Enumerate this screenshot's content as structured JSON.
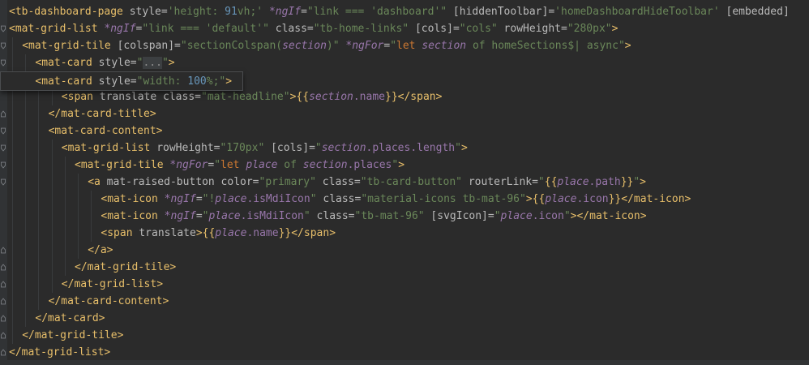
{
  "editor": {
    "background": "#2b2b2b",
    "gutter_background": "#313335",
    "colors": {
      "tag": "#e8bf6a",
      "attribute": "#bababa",
      "string": "#6a8759",
      "keyword": "#cc7832",
      "variable": "#9876aa",
      "number": "#6897bb",
      "text": "#a9b7c6"
    },
    "fold_icon": "fold-marker-icon",
    "lines": [
      {
        "indent": 0,
        "fold": "none",
        "tokens": [
          {
            "t": "<tb-dashboard-page ",
            "c": "tk-tag"
          },
          {
            "t": "style=",
            "c": "tk-attr"
          },
          {
            "t": "'height: ",
            "c": "tk-str"
          },
          {
            "t": "91",
            "c": "tk-num"
          },
          {
            "t": "vh;'",
            "c": "tk-str"
          },
          {
            "t": " ",
            "c": "tk-text"
          },
          {
            "t": "*ngIf",
            "c": "tk-ngs"
          },
          {
            "t": "=",
            "c": "tk-attr"
          },
          {
            "t": "\"link === ",
            "c": "tk-str"
          },
          {
            "t": "'dashboard'",
            "c": "tk-str"
          },
          {
            "t": "\"",
            "c": "tk-str"
          },
          {
            "t": " [hiddenToolbar]",
            "c": "tk-ng"
          },
          {
            "t": "=",
            "c": "tk-attr"
          },
          {
            "t": "'homeDashboardHideToolbar'",
            "c": "tk-str"
          },
          {
            "t": " [embedded]",
            "c": "tk-ng"
          }
        ]
      },
      {
        "indent": 0,
        "fold": "open",
        "tokens": [
          {
            "t": "<mat-grid-list ",
            "c": "tk-tag"
          },
          {
            "t": "*ngIf",
            "c": "tk-ngs"
          },
          {
            "t": "=",
            "c": "tk-attr"
          },
          {
            "t": "\"link === ",
            "c": "tk-str"
          },
          {
            "t": "'default'",
            "c": "tk-str"
          },
          {
            "t": "\"",
            "c": "tk-str"
          },
          {
            "t": " class=",
            "c": "tk-attr"
          },
          {
            "t": "\"tb-home-links\"",
            "c": "tk-str"
          },
          {
            "t": " [cols]",
            "c": "tk-ng"
          },
          {
            "t": "=",
            "c": "tk-attr"
          },
          {
            "t": "\"cols\"",
            "c": "tk-str"
          },
          {
            "t": " rowHeight=",
            "c": "tk-attr"
          },
          {
            "t": "\"280px\"",
            "c": "tk-str"
          },
          {
            "t": ">",
            "c": "tk-tag"
          }
        ]
      },
      {
        "indent": 1,
        "fold": "open",
        "tokens": [
          {
            "t": "<mat-grid-tile ",
            "c": "tk-tag"
          },
          {
            "t": "[colspan]",
            "c": "tk-ng"
          },
          {
            "t": "=",
            "c": "tk-attr"
          },
          {
            "t": "\"sectionColspan(",
            "c": "tk-str"
          },
          {
            "t": "section",
            "c": "tk-var"
          },
          {
            "t": ")\"",
            "c": "tk-str"
          },
          {
            "t": " ",
            "c": "tk-text"
          },
          {
            "t": "*ngFor",
            "c": "tk-ngs"
          },
          {
            "t": "=",
            "c": "tk-attr"
          },
          {
            "t": "\"",
            "c": "tk-str"
          },
          {
            "t": "let ",
            "c": "tk-kw"
          },
          {
            "t": "section",
            "c": "tk-var"
          },
          {
            "t": " of homeSections$| async\"",
            "c": "tk-str"
          },
          {
            "t": ">",
            "c": "tk-tag"
          }
        ]
      },
      {
        "indent": 2,
        "fold": "open",
        "tokens": [
          {
            "t": "<mat-card ",
            "c": "tk-tag"
          },
          {
            "t": "style=",
            "c": "tk-attr"
          },
          {
            "t": "\"",
            "c": "tk-str"
          },
          {
            "t": "...",
            "c": "tk-fold"
          },
          {
            "t": "\"",
            "c": "tk-str"
          },
          {
            "t": ">",
            "c": "tk-tag"
          }
        ]
      },
      {
        "indent": 3,
        "fold": "open",
        "tokens": []
      },
      {
        "indent": 4,
        "fold": "none",
        "tokens": [
          {
            "t": "<span ",
            "c": "tk-tag"
          },
          {
            "t": "translate class=",
            "c": "tk-attr"
          },
          {
            "t": "\"mat-headline\"",
            "c": "tk-str"
          },
          {
            "t": ">",
            "c": "tk-tag"
          },
          {
            "t": "{{",
            "c": "tk-interp"
          },
          {
            "t": "section",
            "c": "tk-var"
          },
          {
            "t": ".name",
            "c": "tk-bind"
          },
          {
            "t": "}}",
            "c": "tk-interp"
          },
          {
            "t": "</span>",
            "c": "tk-tag"
          }
        ]
      },
      {
        "indent": 3,
        "fold": "close",
        "tokens": [
          {
            "t": "</mat-card-title>",
            "c": "tk-tag"
          }
        ]
      },
      {
        "indent": 3,
        "fold": "open",
        "tokens": [
          {
            "t": "<mat-card-content>",
            "c": "tk-tag"
          }
        ]
      },
      {
        "indent": 4,
        "fold": "open",
        "tokens": [
          {
            "t": "<mat-grid-list ",
            "c": "tk-tag"
          },
          {
            "t": "rowHeight=",
            "c": "tk-attr"
          },
          {
            "t": "\"170px\"",
            "c": "tk-str"
          },
          {
            "t": " [cols]",
            "c": "tk-ng"
          },
          {
            "t": "=",
            "c": "tk-attr"
          },
          {
            "t": "\"",
            "c": "tk-str"
          },
          {
            "t": "section",
            "c": "tk-var"
          },
          {
            "t": ".places.length",
            "c": "tk-bind"
          },
          {
            "t": "\"",
            "c": "tk-str"
          },
          {
            "t": ">",
            "c": "tk-tag"
          }
        ]
      },
      {
        "indent": 5,
        "fold": "open",
        "tokens": [
          {
            "t": "<mat-grid-tile ",
            "c": "tk-tag"
          },
          {
            "t": "*ngFor",
            "c": "tk-ngs"
          },
          {
            "t": "=",
            "c": "tk-attr"
          },
          {
            "t": "\"",
            "c": "tk-str"
          },
          {
            "t": "let ",
            "c": "tk-kw"
          },
          {
            "t": "place",
            "c": "tk-var"
          },
          {
            "t": " of ",
            "c": "tk-str"
          },
          {
            "t": "section",
            "c": "tk-var"
          },
          {
            "t": ".places",
            "c": "tk-bind"
          },
          {
            "t": "\"",
            "c": "tk-str"
          },
          {
            "t": ">",
            "c": "tk-tag"
          }
        ]
      },
      {
        "indent": 6,
        "fold": "open",
        "tokens": [
          {
            "t": "<a ",
            "c": "tk-tag"
          },
          {
            "t": "mat-raised-button color=",
            "c": "tk-attr"
          },
          {
            "t": "\"primary\"",
            "c": "tk-str"
          },
          {
            "t": " class=",
            "c": "tk-attr"
          },
          {
            "t": "\"tb-card-button\"",
            "c": "tk-str"
          },
          {
            "t": " routerLink=",
            "c": "tk-attr"
          },
          {
            "t": "\"",
            "c": "tk-str"
          },
          {
            "t": "{{",
            "c": "tk-interp"
          },
          {
            "t": "place",
            "c": "tk-var"
          },
          {
            "t": ".path",
            "c": "tk-bind"
          },
          {
            "t": "}}",
            "c": "tk-interp"
          },
          {
            "t": "\"",
            "c": "tk-str"
          },
          {
            "t": ">",
            "c": "tk-tag"
          }
        ]
      },
      {
        "indent": 7,
        "fold": "none",
        "tokens": [
          {
            "t": "<mat-icon ",
            "c": "tk-tag"
          },
          {
            "t": "*ngIf",
            "c": "tk-ngs"
          },
          {
            "t": "=",
            "c": "tk-attr"
          },
          {
            "t": "\"!",
            "c": "tk-str"
          },
          {
            "t": "place",
            "c": "tk-var"
          },
          {
            "t": ".isMdiIcon",
            "c": "tk-bind"
          },
          {
            "t": "\"",
            "c": "tk-str"
          },
          {
            "t": " class=",
            "c": "tk-attr"
          },
          {
            "t": "\"material-icons tb-mat-96\"",
            "c": "tk-str"
          },
          {
            "t": ">",
            "c": "tk-tag"
          },
          {
            "t": "{{",
            "c": "tk-interp"
          },
          {
            "t": "place",
            "c": "tk-var"
          },
          {
            "t": ".icon",
            "c": "tk-bind"
          },
          {
            "t": "}}",
            "c": "tk-interp"
          },
          {
            "t": "</mat-icon>",
            "c": "tk-tag"
          }
        ]
      },
      {
        "indent": 7,
        "fold": "none",
        "tokens": [
          {
            "t": "<mat-icon ",
            "c": "tk-tag"
          },
          {
            "t": "*ngIf",
            "c": "tk-ngs"
          },
          {
            "t": "=",
            "c": "tk-attr"
          },
          {
            "t": "\"",
            "c": "tk-str"
          },
          {
            "t": "place",
            "c": "tk-var"
          },
          {
            "t": ".isMdiIcon",
            "c": "tk-bind"
          },
          {
            "t": "\"",
            "c": "tk-str"
          },
          {
            "t": " class=",
            "c": "tk-attr"
          },
          {
            "t": "\"tb-mat-96\"",
            "c": "tk-str"
          },
          {
            "t": " [svgIcon]",
            "c": "tk-ng"
          },
          {
            "t": "=",
            "c": "tk-attr"
          },
          {
            "t": "\"",
            "c": "tk-str"
          },
          {
            "t": "place",
            "c": "tk-var"
          },
          {
            "t": ".icon",
            "c": "tk-bind"
          },
          {
            "t": "\"",
            "c": "tk-str"
          },
          {
            "t": "></mat-icon>",
            "c": "tk-tag"
          }
        ]
      },
      {
        "indent": 7,
        "fold": "none",
        "tokens": [
          {
            "t": "<span ",
            "c": "tk-tag"
          },
          {
            "t": "translate",
            "c": "tk-attr"
          },
          {
            "t": ">",
            "c": "tk-tag"
          },
          {
            "t": "{{",
            "c": "tk-interp"
          },
          {
            "t": "place",
            "c": "tk-var"
          },
          {
            "t": ".name",
            "c": "tk-bind"
          },
          {
            "t": "}}",
            "c": "tk-interp"
          },
          {
            "t": "</span>",
            "c": "tk-tag"
          }
        ]
      },
      {
        "indent": 6,
        "fold": "close",
        "tokens": [
          {
            "t": "</a>",
            "c": "tk-tag"
          }
        ]
      },
      {
        "indent": 5,
        "fold": "close",
        "tokens": [
          {
            "t": "</mat-grid-tile>",
            "c": "tk-tag"
          }
        ]
      },
      {
        "indent": 4,
        "fold": "close",
        "tokens": [
          {
            "t": "</mat-grid-list>",
            "c": "tk-tag"
          }
        ]
      },
      {
        "indent": 3,
        "fold": "close",
        "tokens": [
          {
            "t": "</mat-card-content>",
            "c": "tk-tag"
          }
        ]
      },
      {
        "indent": 2,
        "fold": "close",
        "tokens": [
          {
            "t": "</mat-card>",
            "c": "tk-tag"
          }
        ]
      },
      {
        "indent": 1,
        "fold": "close",
        "tokens": [
          {
            "t": "</mat-grid-tile>",
            "c": "tk-tag"
          }
        ]
      },
      {
        "indent": 0,
        "fold": "close",
        "tokens": [
          {
            "t": "</mat-grid-list>",
            "c": "tk-tag"
          }
        ]
      }
    ],
    "popup": {
      "tokens": [
        {
          "t": "<mat-card ",
          "c": "tk-tag"
        },
        {
          "t": "style=",
          "c": "tk-attr"
        },
        {
          "t": "\"width: ",
          "c": "tk-str"
        },
        {
          "t": "100",
          "c": "tk-num"
        },
        {
          "t": "%;\"",
          "c": "tk-str"
        },
        {
          "t": ">",
          "c": "tk-tag"
        }
      ]
    }
  }
}
